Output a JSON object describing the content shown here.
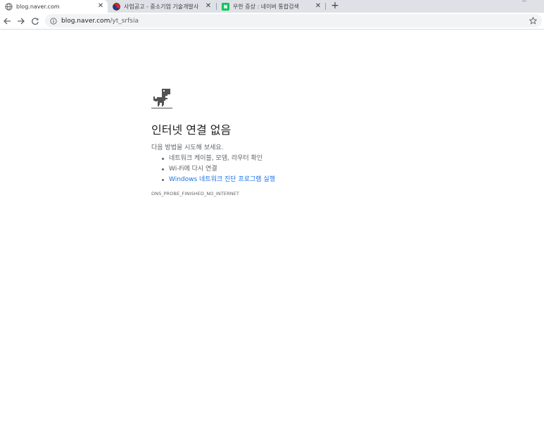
{
  "tabs": [
    {
      "title": "blog.naver.com",
      "active": true,
      "favicon": "globe-icon"
    },
    {
      "title": "사업공고 - 중소기업 기술개발사",
      "active": false,
      "favicon": "taegeuk-icon"
    },
    {
      "title": "우한 증상 : 네이버 통합검색",
      "active": false,
      "favicon": "naver-icon"
    }
  ],
  "toolbar": {
    "url_host": "blog.naver.com",
    "url_path": "/yt_srfsia"
  },
  "error": {
    "title": "인터넷 연결 없음",
    "intro": "다음 방법을 시도해 보세요.",
    "suggestions": [
      "네트워크 케이블, 모뎀, 라우터 확인",
      "Wi-Fi에 다시 연결",
      "Windows 네트워크 진단 프로그램 실행"
    ],
    "code": "DNS_PROBE_FINISHED_NO_INTERNET"
  },
  "colors": {
    "link": "#1a73e8",
    "naver_green": "#03c75a",
    "tabstrip": "#dee1e6"
  }
}
